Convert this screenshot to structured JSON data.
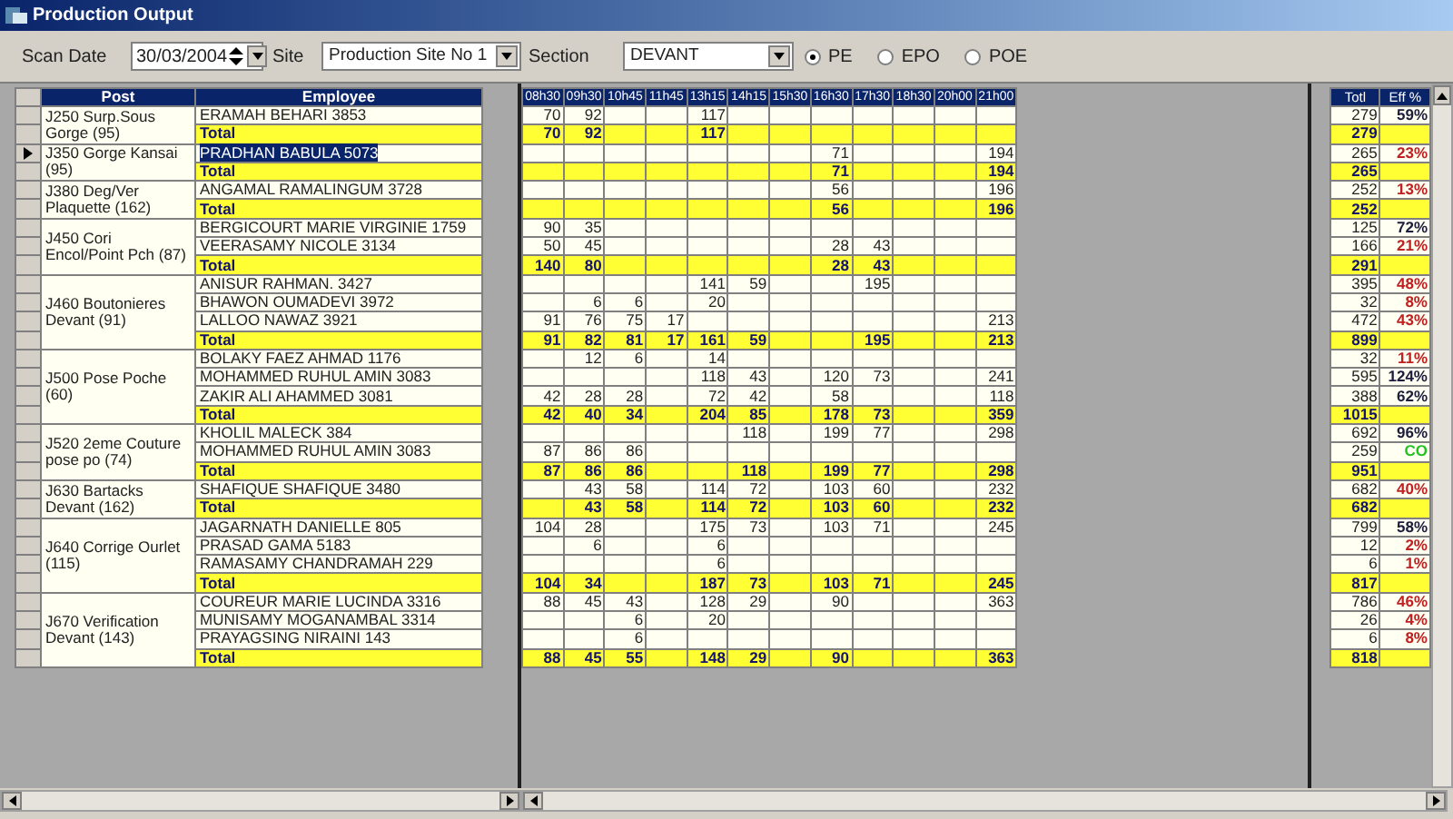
{
  "window": {
    "title": "Production Output"
  },
  "filters": {
    "scan_date_label": "Scan Date",
    "scan_date": "30/03/2004",
    "site_label": "Site",
    "site": "Production Site No 1",
    "section_label": "Section",
    "section": "DEVANT",
    "modes": [
      {
        "label": "PE",
        "selected": true
      },
      {
        "label": "EPO",
        "selected": false
      },
      {
        "label": "POE",
        "selected": false
      }
    ]
  },
  "left_columns": [
    "Post",
    "Employee"
  ],
  "time_columns": [
    "08h30",
    "09h30",
    "10h45",
    "11h45",
    "13h15",
    "14h15",
    "15h30",
    "16h30",
    "17h30",
    "18h30",
    "20h00",
    "21h00"
  ],
  "right_columns": [
    "Totl",
    "Eff %"
  ],
  "groups": [
    {
      "post": "J250 Surp.Sous Gorge (95)",
      "rows": [
        {
          "kind": "employee",
          "employee": "ERAMAH BEHARI 3853",
          "selected": false,
          "hours": {
            "col_1": "70",
            "col_2": "92",
            "col_5": "117"
          },
          "total": "279",
          "eff": {
            "text": "59%",
            "color": "#1c1c3c"
          }
        },
        {
          "kind": "total",
          "employee": "Total",
          "selected": false,
          "hours": {
            "col_1": "70",
            "col_2": "92",
            "col_5": "117"
          },
          "total": "279"
        }
      ]
    },
    {
      "post": "J350 Gorge Kansai (95)",
      "rows": [
        {
          "kind": "employee",
          "employee": "PRADHAN BABULA 5073",
          "selected": true,
          "hours": {
            "col_8": "71",
            "col_12": "194"
          },
          "total": "265",
          "eff": {
            "text": "23%",
            "color": "#c02020"
          }
        },
        {
          "kind": "total",
          "employee": "Total",
          "selected": false,
          "hours": {
            "col_8": "71",
            "col_12": "194"
          },
          "total": "265"
        }
      ]
    },
    {
      "post": "J380 Deg/Ver Plaquette (162)",
      "rows": [
        {
          "kind": "employee",
          "employee": "ANGAMAL RAMALINGUM 3728",
          "selected": false,
          "hours": {
            "col_8": "56",
            "col_12": "196"
          },
          "total": "252",
          "eff": {
            "text": "13%",
            "color": "#c02020"
          }
        },
        {
          "kind": "total",
          "employee": "Total",
          "selected": false,
          "hours": {
            "col_8": "56",
            "col_12": "196"
          },
          "total": "252"
        }
      ]
    },
    {
      "post": "J450 Cori Encol/Point Pch (87)",
      "rows": [
        {
          "kind": "employee",
          "employee": "BERGICOURT MARIE VIRGINIE 1759",
          "selected": false,
          "hours": {
            "col_1": "90",
            "col_2": "35"
          },
          "total": "125",
          "eff": {
            "text": "72%",
            "color": "#1c1c3c"
          }
        },
        {
          "kind": "employee",
          "employee": "VEERASAMY NICOLE 3134",
          "selected": false,
          "hours": {
            "col_1": "50",
            "col_2": "45",
            "col_8": "28",
            "col_9": "43"
          },
          "total": "166",
          "eff": {
            "text": "21%",
            "color": "#c02020"
          }
        },
        {
          "kind": "total",
          "employee": "Total",
          "selected": false,
          "hours": {
            "col_1": "140",
            "col_2": "80",
            "col_8": "28",
            "col_9": "43"
          },
          "total": "291"
        }
      ]
    },
    {
      "post": "J460 Boutonieres Devant (91)",
      "rows": [
        {
          "kind": "employee",
          "employee": "ANISUR RAHMAN. 3427",
          "selected": false,
          "hours": {
            "col_5": "141",
            "col_6": "59",
            "col_9": "195"
          },
          "total": "395",
          "eff": {
            "text": "48%",
            "color": "#c02020"
          }
        },
        {
          "kind": "employee",
          "employee": "BHAWON OUMADEVI 3972",
          "selected": false,
          "hours": {
            "col_2": "6",
            "col_3": "6",
            "col_5": "20"
          },
          "total": "32",
          "eff": {
            "text": "8%",
            "color": "#c02020"
          }
        },
        {
          "kind": "employee",
          "employee": "LALLOO NAWAZ 3921",
          "selected": false,
          "hours": {
            "col_1": "91",
            "col_2": "76",
            "col_3": "75",
            "col_4": "17",
            "col_12": "213"
          },
          "total": "472",
          "eff": {
            "text": "43%",
            "color": "#c02020"
          }
        },
        {
          "kind": "total",
          "employee": "Total",
          "selected": false,
          "hours": {
            "col_1": "91",
            "col_2": "82",
            "col_3": "81",
            "col_4": "17",
            "col_5": "161",
            "col_6": "59",
            "col_9": "195",
            "col_12": "213"
          },
          "total": "899"
        }
      ]
    },
    {
      "post": "J500 Pose Poche (60)",
      "rows": [
        {
          "kind": "employee",
          "employee": "BOLAKY FAEZ  AHMAD 1176",
          "selected": false,
          "hours": {
            "col_2": "12",
            "col_3": "6",
            "col_5": "14"
          },
          "total": "32",
          "eff": {
            "text": "11%",
            "color": "#c02020"
          }
        },
        {
          "kind": "employee",
          "employee": "MOHAMMED RUHUL AMIN 3083",
          "selected": false,
          "hours": {
            "col_5": "118",
            "col_6": "43",
            "col_8": "120",
            "col_9": "73",
            "col_12": "241"
          },
          "total": "595",
          "eff": {
            "text": "124%",
            "color": "#1c1c3c"
          }
        },
        {
          "kind": "employee",
          "employee": "ZAKIR ALI AHAMMED 3081",
          "selected": false,
          "hours": {
            "col_1": "42",
            "col_2": "28",
            "col_3": "28",
            "col_5": "72",
            "col_6": "42",
            "col_8": "58",
            "col_12": "118"
          },
          "total": "388",
          "eff": {
            "text": "62%",
            "color": "#1c1c3c"
          }
        },
        {
          "kind": "total",
          "employee": "Total",
          "selected": false,
          "hours": {
            "col_1": "42",
            "col_2": "40",
            "col_3": "34",
            "col_5": "204",
            "col_6": "85",
            "col_8": "178",
            "col_9": "73",
            "col_12": "359"
          },
          "total": "1015"
        }
      ]
    },
    {
      "post": "J520 2eme Couture pose po (74)",
      "rows": [
        {
          "kind": "employee",
          "employee": "KHOLIL MALECK 384",
          "selected": false,
          "hours": {
            "col_6": "118",
            "col_8": "199",
            "col_9": "77",
            "col_12": "298"
          },
          "total": "692",
          "eff": {
            "text": "96%",
            "color": "#1c1c3c"
          }
        },
        {
          "kind": "employee",
          "employee": "MOHAMMED RUHUL AMIN 3083",
          "selected": false,
          "hours": {
            "col_1": "87",
            "col_2": "86",
            "col_3": "86"
          },
          "total": "259",
          "eff": {
            "text": "CO",
            "color": "#22c022"
          }
        },
        {
          "kind": "total",
          "employee": "Total",
          "selected": false,
          "hours": {
            "col_1": "87",
            "col_2": "86",
            "col_3": "86",
            "col_6": "118",
            "col_8": "199",
            "col_9": "77",
            "col_12": "298"
          },
          "total": "951"
        }
      ]
    },
    {
      "post": "J630 Bartacks Devant (162)",
      "rows": [
        {
          "kind": "employee",
          "employee": "SHAFIQUE SHAFIQUE 3480",
          "selected": false,
          "hours": {
            "col_2": "43",
            "col_3": "58",
            "col_5": "114",
            "col_6": "72",
            "col_8": "103",
            "col_9": "60",
            "col_12": "232"
          },
          "total": "682",
          "eff": {
            "text": "40%",
            "color": "#c02020"
          }
        },
        {
          "kind": "total",
          "employee": "Total",
          "selected": false,
          "hours": {
            "col_2": "43",
            "col_3": "58",
            "col_5": "114",
            "col_6": "72",
            "col_8": "103",
            "col_9": "60",
            "col_12": "232"
          },
          "total": "682"
        }
      ]
    },
    {
      "post": "J640 Corrige Ourlet (115)",
      "rows": [
        {
          "kind": "employee",
          "employee": "JAGARNATH DANIELLE 805",
          "selected": false,
          "hours": {
            "col_1": "104",
            "col_2": "28",
            "col_5": "175",
            "col_6": "73",
            "col_8": "103",
            "col_9": "71",
            "col_12": "245"
          },
          "total": "799",
          "eff": {
            "text": "58%",
            "color": "#1c1c3c"
          }
        },
        {
          "kind": "employee",
          "employee": "PRASAD GAMA 5183",
          "selected": false,
          "hours": {
            "col_2": "6",
            "col_5": "6"
          },
          "total": "12",
          "eff": {
            "text": "2%",
            "color": "#c02020"
          }
        },
        {
          "kind": "employee",
          "employee": "RAMASAMY CHANDRAMAH 229",
          "selected": false,
          "hours": {
            "col_5": "6"
          },
          "total": "6",
          "eff": {
            "text": "1%",
            "color": "#c02020"
          }
        },
        {
          "kind": "total",
          "employee": "Total",
          "selected": false,
          "hours": {
            "col_1": "104",
            "col_2": "34",
            "col_5": "187",
            "col_6": "73",
            "col_8": "103",
            "col_9": "71",
            "col_12": "245"
          },
          "total": "817"
        }
      ]
    },
    {
      "post": "J670 Verification Devant (143)",
      "rows": [
        {
          "kind": "employee",
          "employee": "COUREUR MARIE LUCINDA 3316",
          "selected": false,
          "hours": {
            "col_1": "88",
            "col_2": "45",
            "col_3": "43",
            "col_5": "128",
            "col_6": "29",
            "col_8": "90",
            "col_12": "363"
          },
          "total": "786",
          "eff": {
            "text": "46%",
            "color": "#c02020"
          }
        },
        {
          "kind": "employee",
          "employee": "MUNISAMY MOGANAMBAL 3314",
          "selected": false,
          "hours": {
            "col_3": "6",
            "col_5": "20"
          },
          "total": "26",
          "eff": {
            "text": "4%",
            "color": "#c02020"
          }
        },
        {
          "kind": "employee",
          "employee": "PRAYAGSING NIRAINI 143",
          "selected": false,
          "hours": {
            "col_3": "6"
          },
          "total": "6",
          "eff": {
            "text": "8%",
            "color": "#c02020"
          }
        },
        {
          "kind": "total",
          "employee": "Total",
          "selected": false,
          "hours": {
            "col_1": "88",
            "col_2": "45",
            "col_3": "55",
            "col_5": "148",
            "col_6": "29",
            "col_8": "90",
            "col_12": "363"
          },
          "total": "818"
        }
      ]
    }
  ]
}
